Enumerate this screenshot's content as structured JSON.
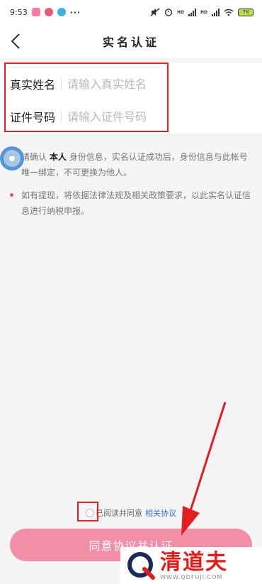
{
  "status_bar": {
    "time": "9:53",
    "more": "···",
    "battery": "78",
    "hd_label": "HD"
  },
  "nav": {
    "title": "实名认证"
  },
  "form": {
    "name_label": "真实姓名",
    "name_placeholder": "请输入真实姓名",
    "id_label": "证件号码",
    "id_placeholder": "请输入证件号码"
  },
  "notes": {
    "note1_pre": "请确认",
    "note1_bold": "本人",
    "note1_post": "身份信息，实名认证成功后，身份信息与此帐号唯一绑定，不可更换为他人。",
    "note2": "如有提现，将依据法律法规及相关政策要求，以此实名认证信息进行纳税申报。"
  },
  "agreement": {
    "text": "已阅读并同意",
    "link": "相关协议"
  },
  "submit": {
    "label": "同意协议并认证"
  },
  "watermark": {
    "title": "清道夫",
    "url": "WWW.QDFUJI.COM"
  },
  "colors": {
    "accent": "#f28ea8",
    "highlight": "#e02020",
    "link": "#2f6fd6"
  }
}
